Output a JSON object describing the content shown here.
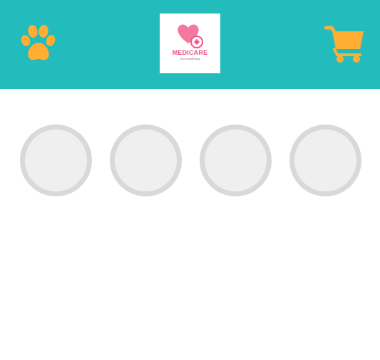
{
  "header": {
    "background_color": "#23bcbc",
    "left_icon": "paw-icon",
    "right_icon": "shopping-cart-icon",
    "icon_color": "#ffae33",
    "logo": {
      "title": "MEDICARE",
      "subtitle": "Your Health App",
      "brand_color": "#f2508a"
    }
  },
  "category_placeholders": {
    "count": 4,
    "border_color": "#d9d9d9",
    "fill_color": "#efefef"
  }
}
